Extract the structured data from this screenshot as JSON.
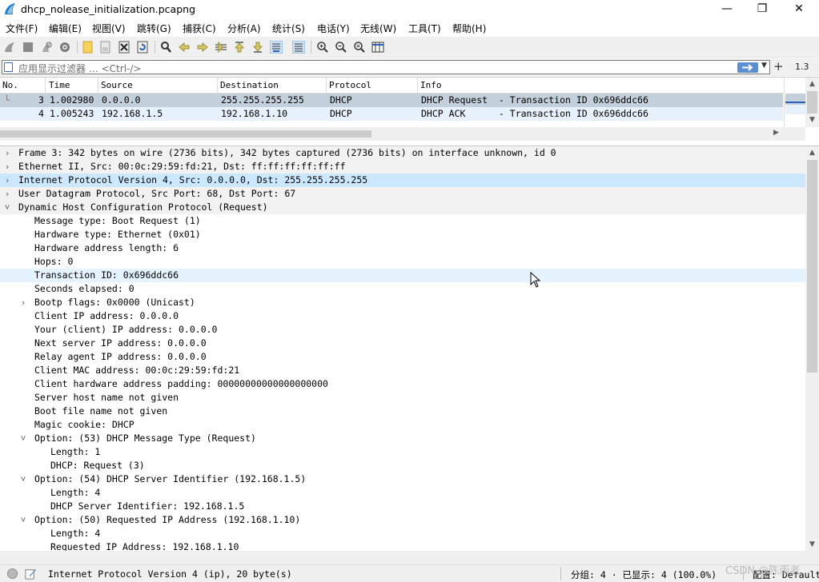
{
  "window": {
    "title": "dhcp_nolease_initialization.pcapng",
    "minimize": "—",
    "maximize": "❐",
    "close": "✕"
  },
  "menu": {
    "items": [
      {
        "label": "文件(F)"
      },
      {
        "label": "编辑(E)"
      },
      {
        "label": "视图(V)"
      },
      {
        "label": "跳转(G)"
      },
      {
        "label": "捕获(C)"
      },
      {
        "label": "分析(A)"
      },
      {
        "label": "统计(S)"
      },
      {
        "label": "电话(Y)"
      },
      {
        "label": "无线(W)"
      },
      {
        "label": "工具(T)"
      },
      {
        "label": "帮助(H)"
      }
    ]
  },
  "filter": {
    "placeholder": "应用显示过滤器 … <Ctrl-/>",
    "plus": "+",
    "version": "1.3"
  },
  "packet_list": {
    "columns": [
      "No.",
      "Time",
      "Source",
      "Destination",
      "Protocol",
      "Info"
    ],
    "rows": [
      {
        "no": "3",
        "time": "1.002980",
        "source": "0.0.0.0",
        "destination": "255.255.255.255",
        "protocol": "DHCP",
        "info": "DHCP Request  - Transaction ID 0x696ddc66"
      },
      {
        "no": "4",
        "time": "1.005243",
        "source": "192.168.1.5",
        "destination": "192.168.1.10",
        "protocol": "DHCP",
        "info": "DHCP ACK      - Transaction ID 0x696ddc66"
      }
    ]
  },
  "details": {
    "rows": [
      {
        "arrow": "›",
        "text": "Frame 3: 342 bytes on wire (2736 bits), 342 bytes captured (2736 bits) on interface unknown, id 0"
      },
      {
        "arrow": "›",
        "text": "Ethernet II, Src: 00:0c:29:59:fd:21, Dst: ff:ff:ff:ff:ff:ff"
      },
      {
        "arrow": "›",
        "text": "Internet Protocol Version 4, Src: 0.0.0.0, Dst: 255.255.255.255"
      },
      {
        "arrow": "›",
        "text": "User Datagram Protocol, Src Port: 68, Dst Port: 67"
      },
      {
        "arrow": "˅",
        "text": "Dynamic Host Configuration Protocol (Request)"
      },
      {
        "arrow": "",
        "text": "Message type: Boot Request (1)"
      },
      {
        "arrow": "",
        "text": "Hardware type: Ethernet (0x01)"
      },
      {
        "arrow": "",
        "text": "Hardware address length: 6"
      },
      {
        "arrow": "",
        "text": "Hops: 0"
      },
      {
        "arrow": "",
        "text": "Transaction ID: 0x696ddc66"
      },
      {
        "arrow": "",
        "text": "Seconds elapsed: 0"
      },
      {
        "arrow": "›",
        "text": "Bootp flags: 0x0000 (Unicast)"
      },
      {
        "arrow": "",
        "text": "Client IP address: 0.0.0.0"
      },
      {
        "arrow": "",
        "text": "Your (client) IP address: 0.0.0.0"
      },
      {
        "arrow": "",
        "text": "Next server IP address: 0.0.0.0"
      },
      {
        "arrow": "",
        "text": "Relay agent IP address: 0.0.0.0"
      },
      {
        "arrow": "",
        "text": "Client MAC address: 00:0c:29:59:fd:21"
      },
      {
        "arrow": "",
        "text": "Client hardware address padding: 00000000000000000000"
      },
      {
        "arrow": "",
        "text": "Server host name not given"
      },
      {
        "arrow": "",
        "text": "Boot file name not given"
      },
      {
        "arrow": "",
        "text": "Magic cookie: DHCP"
      },
      {
        "arrow": "˅",
        "text": "Option: (53) DHCP Message Type (Request)"
      },
      {
        "arrow": "",
        "text": "Length: 1"
      },
      {
        "arrow": "",
        "text": "DHCP: Request (3)"
      },
      {
        "arrow": "˅",
        "text": "Option: (54) DHCP Server Identifier (192.168.1.5)"
      },
      {
        "arrow": "",
        "text": "Length: 4"
      },
      {
        "arrow": "",
        "text": "DHCP Server Identifier: 192.168.1.5"
      },
      {
        "arrow": "˅",
        "text": "Option: (50) Requested IP Address (192.168.1.10)"
      },
      {
        "arrow": "",
        "text": "Length: 4"
      },
      {
        "arrow": "",
        "text": "Requested IP Address: 192.168.1.10"
      }
    ]
  },
  "status": {
    "field": "Internet Protocol Version 4 (ip), 20 byte(s)",
    "counts": "分组: 4 · 已显示: 4 (100.0%)",
    "profile": "配置: Default"
  },
  "watermark": "CSDN @陈雨老",
  "colors": {
    "selected_row": "#c3d0dc",
    "alt_row": "#e7f1fb",
    "highlight": "#cce8ff",
    "section_bg": "#f2f2f2"
  }
}
